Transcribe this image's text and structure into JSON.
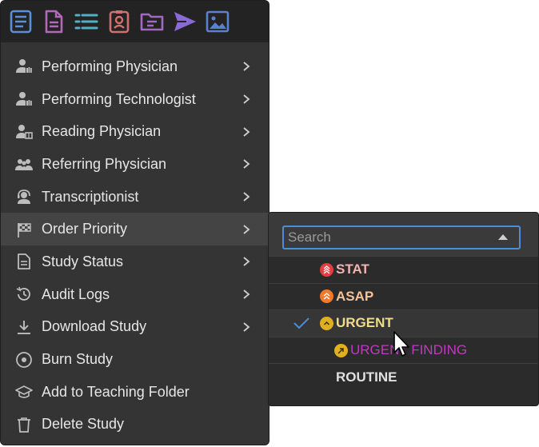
{
  "toolbar": {
    "icons": [
      {
        "name": "report-icon",
        "color": "#5b8fd6"
      },
      {
        "name": "document-icon",
        "color": "#b06ab8"
      },
      {
        "name": "list-icon",
        "color": "#4fb0c6"
      },
      {
        "name": "id-badge-icon",
        "color": "#d0706f"
      },
      {
        "name": "folder-icon",
        "color": "#a06ac0"
      },
      {
        "name": "send-icon",
        "color": "#8a6ad8"
      },
      {
        "name": "image-icon",
        "color": "#5a80d0"
      }
    ]
  },
  "menu": {
    "items": [
      {
        "label": "Performing Physician",
        "icon": "user-hand-icon",
        "submenu": true
      },
      {
        "label": "Performing Technologist",
        "icon": "user-hand-icon",
        "submenu": true
      },
      {
        "label": "Reading Physician",
        "icon": "user-read-icon",
        "submenu": true
      },
      {
        "label": "Referring Physician",
        "icon": "users-icon",
        "submenu": true
      },
      {
        "label": "Transcriptionist",
        "icon": "headset-icon",
        "submenu": true
      },
      {
        "label": "Order Priority",
        "icon": "checkered-flag-icon",
        "submenu": true,
        "active": true
      },
      {
        "label": "Study Status",
        "icon": "file-icon",
        "submenu": true
      },
      {
        "label": "Audit Logs",
        "icon": "history-icon",
        "submenu": true
      },
      {
        "label": "Download Study",
        "icon": "download-icon",
        "submenu": true
      },
      {
        "label": "Burn Study",
        "icon": "disc-icon",
        "submenu": false
      },
      {
        "label": "Add to Teaching Folder",
        "icon": "graduation-cap-icon",
        "submenu": false
      },
      {
        "label": "Delete Study",
        "icon": "trash-icon",
        "submenu": false
      }
    ]
  },
  "submenu": {
    "search_placeholder": "Search",
    "options": [
      {
        "label": "STAT",
        "color": "#f4b3b3",
        "badge_color": "#e24040",
        "badge_icon": "triple-chevron-up-icon",
        "selected": false
      },
      {
        "label": "ASAP",
        "color": "#f5c39a",
        "badge_color": "#f07a2a",
        "badge_icon": "double-chevron-up-icon",
        "selected": false
      },
      {
        "label": "URGENT",
        "color": "#f2dc8a",
        "badge_color": "#e0b020",
        "badge_icon": "chevron-up-icon",
        "selected": true
      },
      {
        "label": "URGENT FINDING",
        "color": "#c03ac0",
        "badge_color": "#e0b020",
        "badge_icon": "arrow-up-right-icon",
        "selected": false,
        "indent": true
      },
      {
        "label": "ROUTINE",
        "color": "#e0e0e0",
        "badge_color": "",
        "badge_icon": "",
        "selected": false
      }
    ],
    "check_color": "#4a8fd6"
  }
}
